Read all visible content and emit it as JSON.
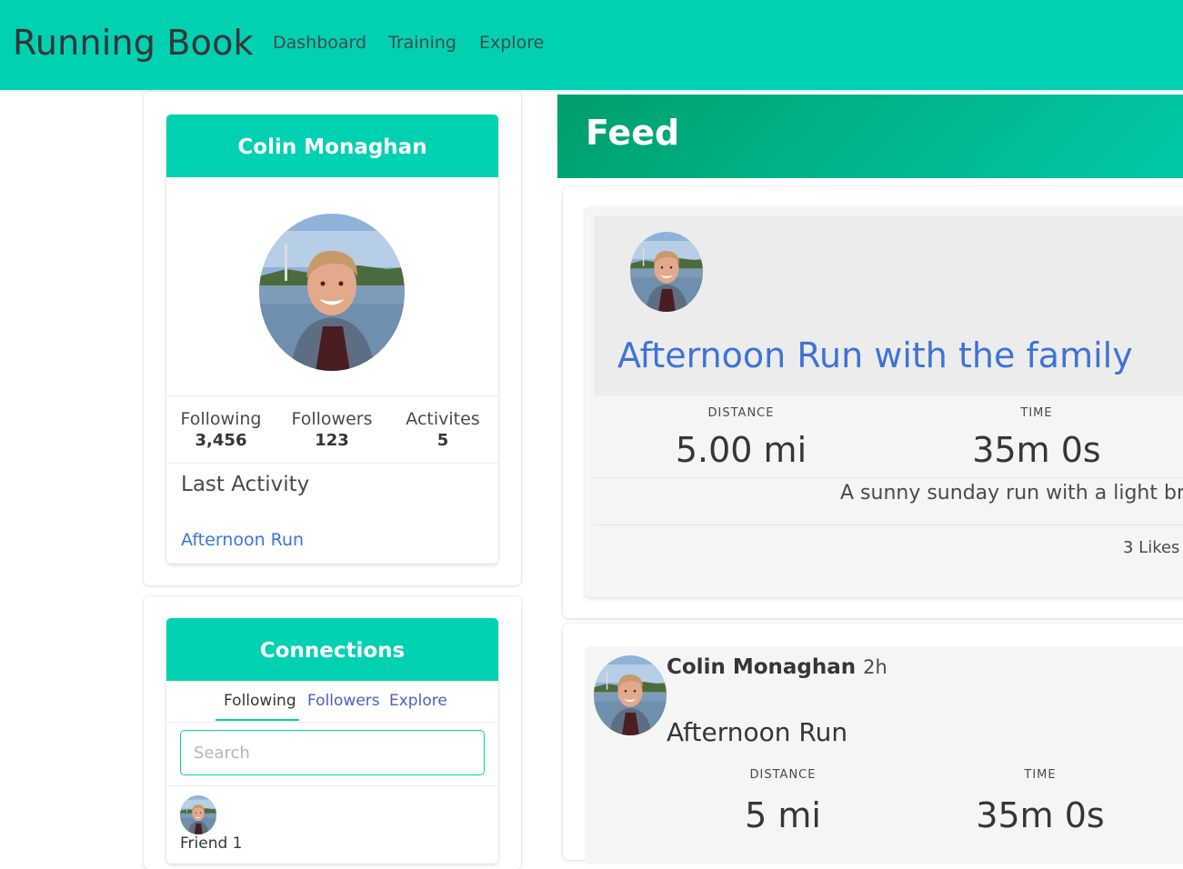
{
  "app": {
    "brand": "Running Book"
  },
  "nav": {
    "links": [
      "Dashboard",
      "Training",
      "Explore"
    ]
  },
  "profile": {
    "name": "Colin Monaghan",
    "stats": [
      {
        "label": "Following",
        "value": "3,456"
      },
      {
        "label": "Followers",
        "value": "123"
      },
      {
        "label": "Activites",
        "value": "5"
      }
    ],
    "last_activity_title": "Last Activity",
    "last_activity_link": "Afternoon Run"
  },
  "connections": {
    "title": "Connections",
    "tabs": [
      "Following",
      "Followers",
      "Explore"
    ],
    "active_tab": "Following",
    "search_placeholder": "Search",
    "friends": [
      "Friend 1"
    ]
  },
  "feed": {
    "title": "Feed",
    "posts": [
      {
        "title": "Afternoon Run with the family",
        "metrics": [
          {
            "label": "DISTANCE",
            "value": "5.00 mi"
          },
          {
            "label": "TIME",
            "value": "35m 0s"
          }
        ],
        "description": "A sunny sunday run with a light br",
        "likes": "3 Likes"
      },
      {
        "author": "Colin Monaghan",
        "time_ago": "2h",
        "title": "Afternoon Run",
        "metrics": [
          {
            "label": "DISTANCE",
            "value": "5 mi"
          },
          {
            "label": "TIME",
            "value": "35m 0s"
          }
        ]
      }
    ]
  },
  "colors": {
    "primary": "#00d1b2",
    "link": "#3e73d6",
    "feed_gradient_start": "#009e6c"
  }
}
